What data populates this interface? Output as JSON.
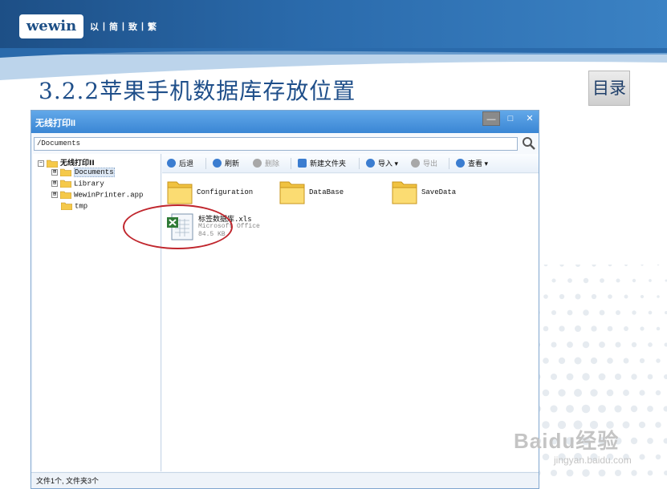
{
  "slide": {
    "logo": "wewin",
    "tagline": "以丨简丨致丨繁",
    "title": "3.2.2苹果手机数据库存放位置",
    "toc_label": "目录",
    "watermark": "Baidu经验",
    "watermark_url": "jingyan.baidu.com"
  },
  "window": {
    "title": "无线打印II",
    "minimize_symbol": "—",
    "maximize_symbol": "□",
    "close_symbol": "✕",
    "address": "/Documents",
    "search_icon": "search-icon"
  },
  "tree": {
    "root": "无线打印II",
    "items": [
      {
        "label": "Documents",
        "expander": "⊞",
        "selected": true
      },
      {
        "label": "Library",
        "expander": "⊞"
      },
      {
        "label": "WewinPrinter.app",
        "expander": "⊞"
      },
      {
        "label": "tmp",
        "expander": ""
      }
    ]
  },
  "toolbar": {
    "back": "后退",
    "refresh": "刷新",
    "delete": "删除",
    "new_folder": "新建文件夹",
    "import": "导入",
    "export": "导出",
    "view": "查看",
    "dropdown": "▾"
  },
  "content": {
    "folders": [
      "Configuration",
      "DataBase",
      "SaveData"
    ],
    "file": {
      "name": "标签数据库.xls",
      "type": "Microsoft Office",
      "size": "84.5 KB"
    }
  },
  "status": "文件1个, 文件夹3个",
  "colors": {
    "accent": "#3a86d4",
    "highlight_ring": "#c0262d",
    "title_text": "#1f4f8a"
  }
}
